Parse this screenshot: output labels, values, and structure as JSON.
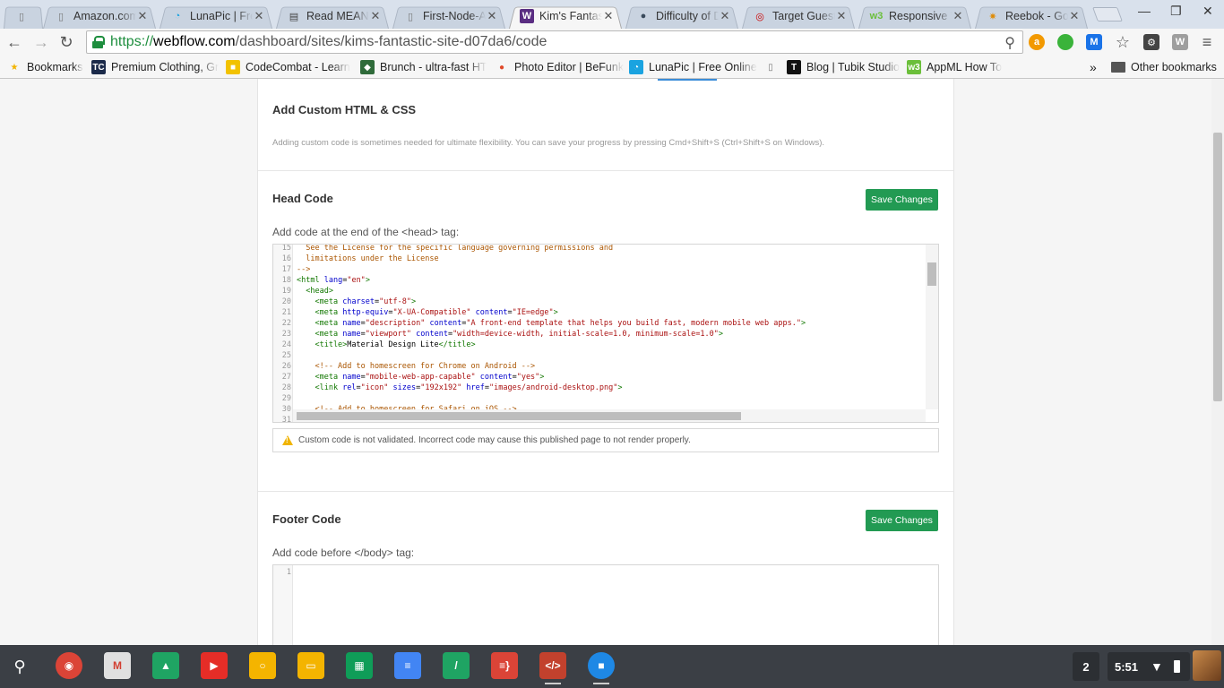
{
  "browser": {
    "tabs": [
      {
        "title": "",
        "favicon": "document-icon",
        "color": "#777777",
        "active": false
      },
      {
        "title": "Amazon.com",
        "favicon": "document-icon",
        "color": "#777777",
        "active": false
      },
      {
        "title": "LunaPic | Free",
        "favicon": "lunapic-icon",
        "color": "#1aa3e0",
        "active": false
      },
      {
        "title": "Read MEAN M",
        "favicon": "book-icon",
        "color": "#444444",
        "active": false
      },
      {
        "title": "First-Node-Ap",
        "favicon": "document-icon",
        "color": "#777777",
        "active": false
      },
      {
        "title": "Kim's Fantast",
        "favicon": "webflow-icon",
        "color": "#5a2d82",
        "active": true
      },
      {
        "title": "Difficulty of D",
        "favicon": "chat-icon",
        "color": "#3a4a5c",
        "active": false
      },
      {
        "title": "Target Guest",
        "favicon": "target-icon",
        "color": "#cc0000",
        "active": false
      },
      {
        "title": "Responsive W",
        "favicon": "w3-icon",
        "color": "#6bbf3a",
        "active": false
      },
      {
        "title": "Reebok - Goo",
        "favicon": "google-photos-icon",
        "color": "#e08a00",
        "active": false
      }
    ],
    "url": {
      "scheme": "https://",
      "host": "webflow.com",
      "path": "/dashboard/sites/kims-fantastic-site-d07da6/code"
    },
    "bookmarks": [
      {
        "label": "Bookmarks",
        "icon": "star-icon",
        "color": "#f2b400"
      },
      {
        "label": "Premium Clothing, Gr",
        "icon": "tc-icon",
        "color": "#1b2a4a"
      },
      {
        "label": "CodeCombat - Learn",
        "icon": "codecombat-icon",
        "color": "#f2c200"
      },
      {
        "label": "Brunch - ultra-fast HT",
        "icon": "brunch-icon",
        "color": "#2f6b3a"
      },
      {
        "label": "Photo Editor | BeFunk",
        "icon": "befunky-icon",
        "color": "#e04a2a"
      },
      {
        "label": "LunaPic | Free Online",
        "icon": "lunapic-icon",
        "color": "#1aa3e0"
      },
      {
        "label": "",
        "icon": "document-icon",
        "color": "#777777"
      },
      {
        "label": "Blog | Tubik Studio",
        "icon": "tubik-icon",
        "color": "#111111"
      },
      {
        "label": "AppML How To",
        "icon": "w3-icon",
        "color": "#6bbf3a"
      }
    ],
    "bookmarks_overflow": "»",
    "other_bookmarks": "Other bookmarks"
  },
  "main": {
    "custom_title": "Add Custom HTML & CSS",
    "custom_desc": "Adding custom code is sometimes needed for ultimate flexibility. You can save your progress by pressing Cmd+Shift+S (Ctrl+Shift+S on Windows).",
    "head": {
      "title": "Head Code",
      "save_label": "Save Changes",
      "instruction": "Add code at the end of the <head> tag:",
      "lines": [
        {
          "n": "15",
          "tokens": [
            [
              "com",
              "  See the License for the specific language governing permissions and"
            ]
          ]
        },
        {
          "n": "16",
          "tokens": [
            [
              "com",
              "  limitations under the License"
            ]
          ]
        },
        {
          "n": "17",
          "tokens": [
            [
              "com",
              "-->"
            ]
          ]
        },
        {
          "n": "18",
          "tokens": [
            [
              "tag",
              "<html "
            ],
            [
              "attr",
              "lang"
            ],
            [
              "txt",
              "="
            ],
            [
              "str",
              "\"en\""
            ],
            [
              "tag",
              ">"
            ]
          ]
        },
        {
          "n": "19",
          "tokens": [
            [
              "tag",
              "  <head>"
            ]
          ]
        },
        {
          "n": "20",
          "tokens": [
            [
              "tag",
              "    <meta "
            ],
            [
              "attr",
              "charset"
            ],
            [
              "txt",
              "="
            ],
            [
              "str",
              "\"utf-8\""
            ],
            [
              "tag",
              ">"
            ]
          ]
        },
        {
          "n": "21",
          "tokens": [
            [
              "tag",
              "    <meta "
            ],
            [
              "attr",
              "http-equiv"
            ],
            [
              "txt",
              "="
            ],
            [
              "str",
              "\"X-UA-Compatible\""
            ],
            [
              "txt",
              " "
            ],
            [
              "attr",
              "content"
            ],
            [
              "txt",
              "="
            ],
            [
              "str",
              "\"IE=edge\""
            ],
            [
              "tag",
              ">"
            ]
          ]
        },
        {
          "n": "22",
          "tokens": [
            [
              "tag",
              "    <meta "
            ],
            [
              "attr",
              "name"
            ],
            [
              "txt",
              "="
            ],
            [
              "str",
              "\"description\""
            ],
            [
              "txt",
              " "
            ],
            [
              "attr",
              "content"
            ],
            [
              "txt",
              "="
            ],
            [
              "str",
              "\"A front-end template that helps you build fast, modern mobile web apps.\""
            ],
            [
              "tag",
              ">"
            ]
          ]
        },
        {
          "n": "23",
          "tokens": [
            [
              "tag",
              "    <meta "
            ],
            [
              "attr",
              "name"
            ],
            [
              "txt",
              "="
            ],
            [
              "str",
              "\"viewport\""
            ],
            [
              "txt",
              " "
            ],
            [
              "attr",
              "content"
            ],
            [
              "txt",
              "="
            ],
            [
              "str",
              "\"width=device-width, initial-scale=1.0, minimum-scale=1.0\""
            ],
            [
              "tag",
              ">"
            ]
          ]
        },
        {
          "n": "24",
          "tokens": [
            [
              "tag",
              "    <title>"
            ],
            [
              "txt",
              "Material Design Lite"
            ],
            [
              "tag",
              "</title>"
            ]
          ]
        },
        {
          "n": "25",
          "tokens": []
        },
        {
          "n": "26",
          "tokens": [
            [
              "com",
              "    <!-- Add to homescreen for Chrome on Android -->"
            ]
          ]
        },
        {
          "n": "27",
          "tokens": [
            [
              "tag",
              "    <meta "
            ],
            [
              "attr",
              "name"
            ],
            [
              "txt",
              "="
            ],
            [
              "str",
              "\"mobile-web-app-capable\""
            ],
            [
              "txt",
              " "
            ],
            [
              "attr",
              "content"
            ],
            [
              "txt",
              "="
            ],
            [
              "str",
              "\"yes\""
            ],
            [
              "tag",
              ">"
            ]
          ]
        },
        {
          "n": "28",
          "tokens": [
            [
              "tag",
              "    <link "
            ],
            [
              "attr",
              "rel"
            ],
            [
              "txt",
              "="
            ],
            [
              "str",
              "\"icon\""
            ],
            [
              "txt",
              " "
            ],
            [
              "attr",
              "sizes"
            ],
            [
              "txt",
              "="
            ],
            [
              "str",
              "\"192x192\""
            ],
            [
              "txt",
              " "
            ],
            [
              "attr",
              "href"
            ],
            [
              "txt",
              "="
            ],
            [
              "str",
              "\"images/android-desktop.png\""
            ],
            [
              "tag",
              ">"
            ]
          ]
        },
        {
          "n": "29",
          "tokens": []
        },
        {
          "n": "30",
          "tokens": [
            [
              "com",
              "    <!-- Add to homescreen for Safari on iOS -->"
            ]
          ]
        },
        {
          "n": "31",
          "tokens": []
        }
      ]
    },
    "warning": "Custom code is not validated. Incorrect code may cause this published page to not render properly.",
    "footer": {
      "title": "Footer Code",
      "save_label": "Save Changes",
      "instruction": "Add code before </body> tag:",
      "lines": [
        {
          "n": "1",
          "tokens": []
        }
      ]
    }
  },
  "shelf": {
    "apps": [
      {
        "name": "chrome-icon",
        "color": "#db4437"
      },
      {
        "name": "gmail-icon",
        "color": "#e0e0e0"
      },
      {
        "name": "drive-icon",
        "color": "#1fa463"
      },
      {
        "name": "youtube-icon",
        "color": "#e52d27"
      },
      {
        "name": "keep-icon",
        "color": "#f4b400"
      },
      {
        "name": "slides-icon",
        "color": "#f4b400"
      },
      {
        "name": "sheets-icon",
        "color": "#0f9d58"
      },
      {
        "name": "docs-icon",
        "color": "#4285f4"
      },
      {
        "name": "slash-app-icon",
        "color": "#1fa463"
      },
      {
        "name": "text-editor-icon",
        "color": "#db4437"
      },
      {
        "name": "code-editor-icon",
        "color": "#c2412d"
      },
      {
        "name": "files-icon",
        "color": "#1e88e5"
      }
    ],
    "notification_count": "2",
    "time": "5:51"
  }
}
